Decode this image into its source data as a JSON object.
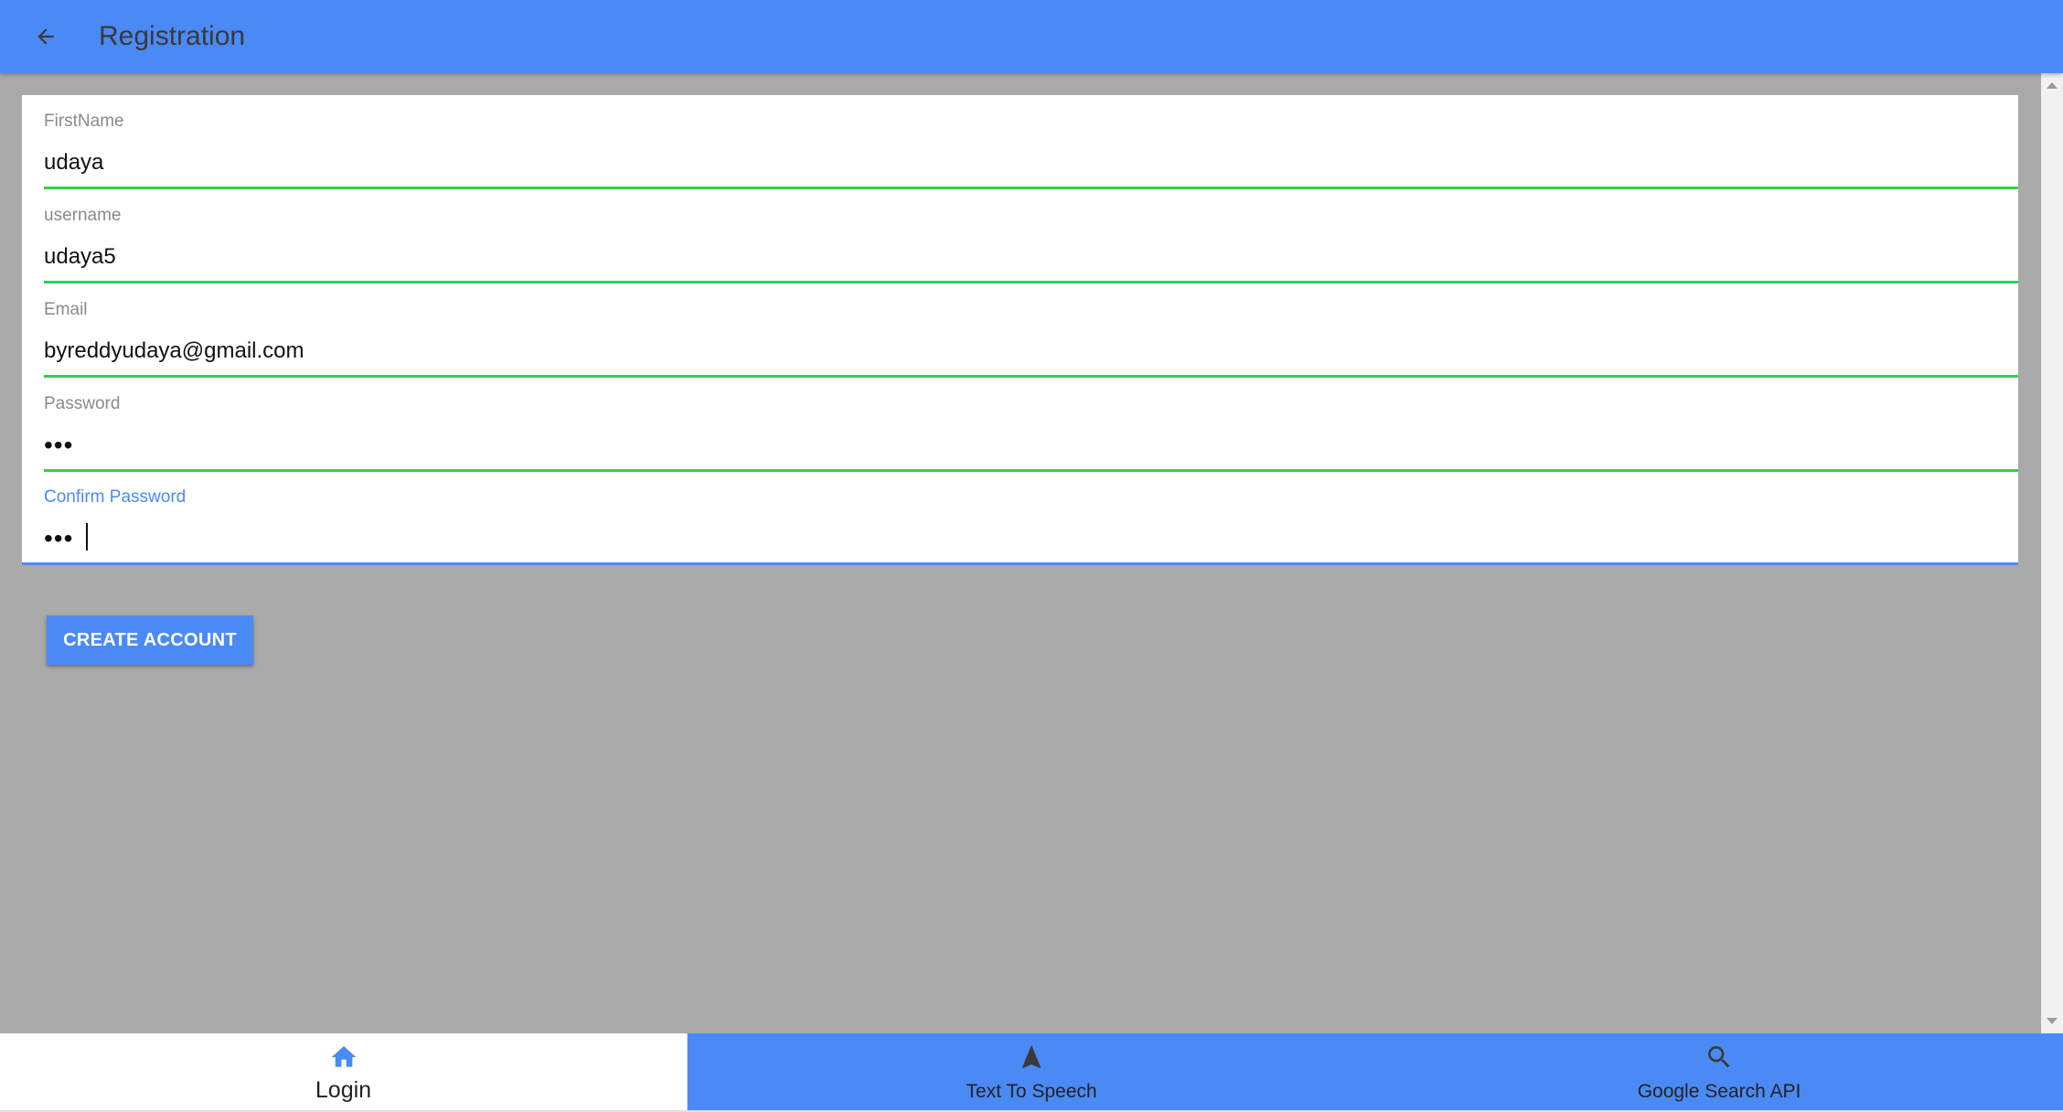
{
  "header": {
    "title": "Registration",
    "back_icon": "arrow-left-icon"
  },
  "form": {
    "fields": [
      {
        "label": "FirstName",
        "value": "udaya"
      },
      {
        "label": "username",
        "value": "udaya5"
      },
      {
        "label": "Email",
        "value": "byreddyudaya@gmail.com"
      },
      {
        "label": "Password",
        "value": "•••"
      },
      {
        "label": "Confirm Password",
        "value": "•••",
        "focused": true
      }
    ],
    "valid_color": "#2fd14d",
    "focus_color": "#4a8af4"
  },
  "actions": {
    "create_account_label": "CREATE ACCOUNT"
  },
  "bottom_nav": {
    "tabs": [
      {
        "label": "Login",
        "icon": "home-icon",
        "active": true
      },
      {
        "label": "Text To Speech",
        "icon": "navigation-arrow-icon",
        "active": false
      },
      {
        "label": "Google Search API",
        "icon": "search-icon",
        "active": false
      }
    ]
  },
  "colors": {
    "primary": "#4a8af4",
    "backdrop": "#aaaaaa"
  }
}
